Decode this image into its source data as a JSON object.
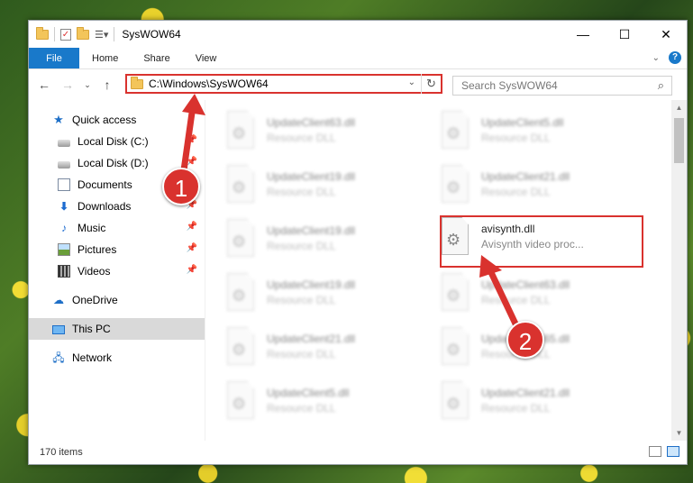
{
  "window": {
    "title": "SysWOW64"
  },
  "ribbon": {
    "tabs": [
      "File",
      "Home",
      "Share",
      "View"
    ],
    "help": "?"
  },
  "navbar": {
    "path": "C:\\Windows\\SysWOW64",
    "search_placeholder": "Search SysWOW64"
  },
  "sidebar": {
    "items": [
      {
        "label": "Quick access",
        "icon": "star-icon"
      },
      {
        "label": "Local Disk (C:)",
        "icon": "disk-icon"
      },
      {
        "label": "Local Disk (D:)",
        "icon": "disk-icon"
      },
      {
        "label": "Documents",
        "icon": "documents-icon"
      },
      {
        "label": "Downloads",
        "icon": "downloads-icon"
      },
      {
        "label": "Music",
        "icon": "music-icon"
      },
      {
        "label": "Pictures",
        "icon": "pictures-icon"
      },
      {
        "label": "Videos",
        "icon": "videos-icon"
      },
      {
        "label": "OneDrive",
        "icon": "cloud-icon"
      },
      {
        "label": "This PC",
        "icon": "pc-icon"
      },
      {
        "label": "Network",
        "icon": "network-icon"
      }
    ]
  },
  "files": [
    {
      "name": "UpdateClient63.dll",
      "type": "Resource DLL"
    },
    {
      "name": "UpdateClient5.dll",
      "type": "Resource DLL"
    },
    {
      "name": "UpdateClient19.dll",
      "type": "Resource DLL"
    },
    {
      "name": "UpdateClient21.dll",
      "type": "Resource DLL"
    },
    {
      "name": "UpdateClient19.dll",
      "type": "Resource DLL"
    },
    {
      "name": "avisynth.dll",
      "type": "Avisynth video proc..."
    },
    {
      "name": "UpdateClient19.dll",
      "type": "Resource DLL"
    },
    {
      "name": "UpdateClient63.dll",
      "type": "Resource DLL"
    },
    {
      "name": "UpdateClient21.dll",
      "type": "Resource DLL"
    },
    {
      "name": "UpdateClient65.dll",
      "type": "Resource DLL"
    },
    {
      "name": "UpdateClient5.dll",
      "type": "Resource DLL"
    },
    {
      "name": "UpdateClient21.dll",
      "type": "Resource DLL"
    }
  ],
  "status": {
    "count": "170 items"
  },
  "callouts": [
    "1",
    "2"
  ],
  "colors": {
    "accent": "#1979ca",
    "highlight": "#d9322e"
  }
}
